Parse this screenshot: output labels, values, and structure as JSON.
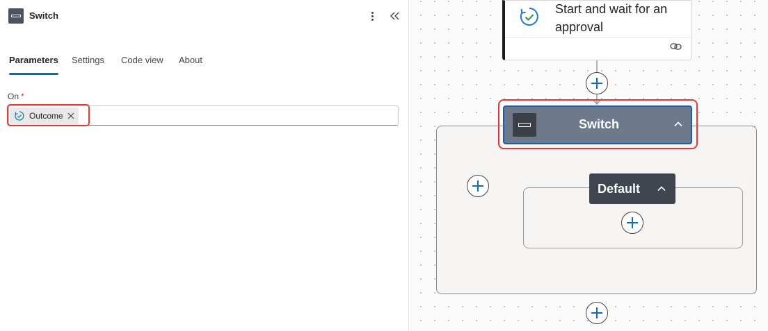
{
  "panel": {
    "title": "Switch",
    "tabs": [
      {
        "label": "Parameters",
        "active": true
      },
      {
        "label": "Settings",
        "active": false
      },
      {
        "label": "Code view",
        "active": false
      },
      {
        "label": "About",
        "active": false
      }
    ],
    "field": {
      "label": "On",
      "required_mark": "*",
      "token": {
        "label": "Outcome",
        "icon": "approval-icon"
      }
    }
  },
  "canvas": {
    "approval_action": {
      "title": "Start and wait for an approval",
      "icon": "approval-icon"
    },
    "switch_action": {
      "title": "Switch",
      "icon": "switch-icon"
    },
    "default_case": {
      "title": "Default"
    }
  },
  "colors": {
    "accent": "#0f6cbd",
    "highlight": "#e03a3a",
    "switch_card": "#6e7a8c",
    "default_header": "#3f4650"
  }
}
